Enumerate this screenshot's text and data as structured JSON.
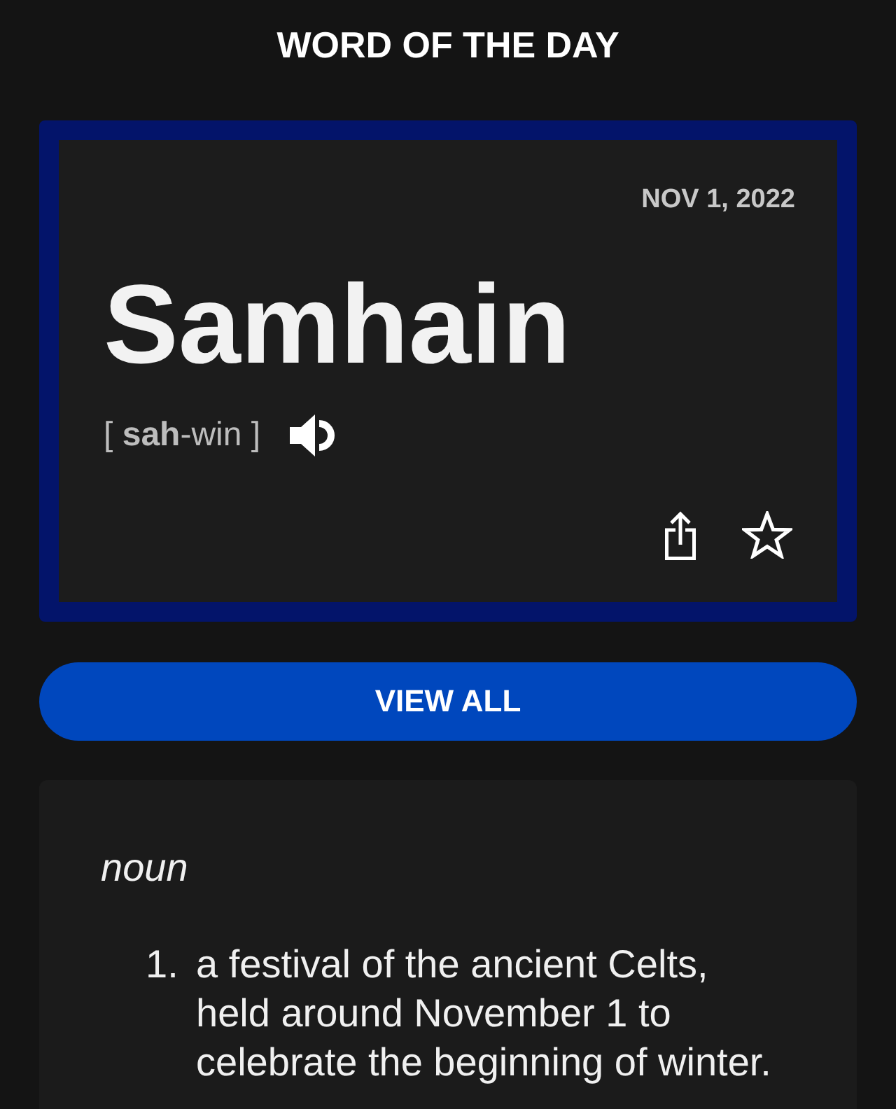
{
  "header": {
    "title": "WORD OF THE DAY"
  },
  "word_card": {
    "date": "NOV 1, 2022",
    "word": "Samhain",
    "pronunciation": "[ **sah**-win ]",
    "actions": [
      {
        "kind": "share"
      },
      {
        "kind": "favorite",
        "favorited": false
      }
    ]
  },
  "button": {
    "label": "VIEW ALL"
  },
  "definition": {
    "part_of_speech": "noun",
    "senses": [
      {
        "number": "1.",
        "text": "a festival of the ancient Celts, held around November 1 to celebrate the beginning of winter."
      }
    ]
  }
}
